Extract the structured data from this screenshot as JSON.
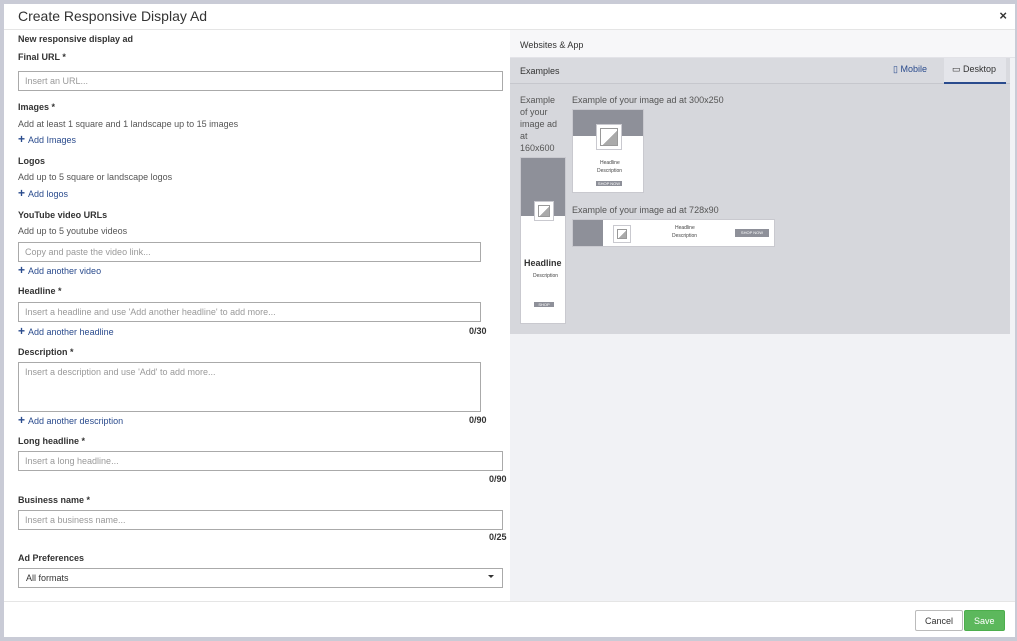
{
  "modal": {
    "title": "Create Responsive Display Ad",
    "close": "×"
  },
  "form": {
    "section_title": "New responsive display ad",
    "final_url": {
      "label": "Final URL *",
      "placeholder": "Insert an URL..."
    },
    "images": {
      "label": "Images *",
      "hint": "Add at least 1 square and 1 landscape up to 15 images",
      "add": "Add Images"
    },
    "logos": {
      "label": "Logos",
      "hint": "Add up to 5 square or landscape logos",
      "add": "Add logos"
    },
    "youtube": {
      "label": "YouTube video URLs",
      "hint": "Add up to 5 youtube videos",
      "placeholder": "Copy and paste the video link...",
      "add": "Add another video"
    },
    "headline": {
      "label": "Headline *",
      "placeholder": "Insert a headline and use 'Add another headline' to add more...",
      "add": "Add another headline",
      "count": "0/30"
    },
    "description": {
      "label": "Description *",
      "placeholder": "Insert a description and use 'Add' to add more...",
      "add": "Add another description",
      "count": "0/90"
    },
    "long_headline": {
      "label": "Long headline *",
      "placeholder": "Insert a long headline...",
      "count": "0/90"
    },
    "business_name": {
      "label": "Business name *",
      "placeholder": "Insert a business name...",
      "count": "0/25"
    },
    "ad_preferences": {
      "label": "Ad Preferences",
      "selected": "All formats"
    }
  },
  "preview": {
    "header": "Websites & App",
    "examples": "Examples",
    "tabs": {
      "mobile": "Mobile",
      "desktop": "Desktop"
    },
    "ex160": "Example of your image ad at 160x600",
    "ex300": "Example of your image ad at 300x250",
    "ex728": "Example of your image ad at 728x90",
    "ad_headline": "Headline",
    "ad_description": "Description",
    "ad_cta": "SHOP NOW"
  },
  "footer": {
    "cancel": "Cancel",
    "save": "Save"
  },
  "colors": {
    "link": "#2a4b8d",
    "save": "#5cb85c",
    "tab_underline": "#2a4b8d"
  }
}
